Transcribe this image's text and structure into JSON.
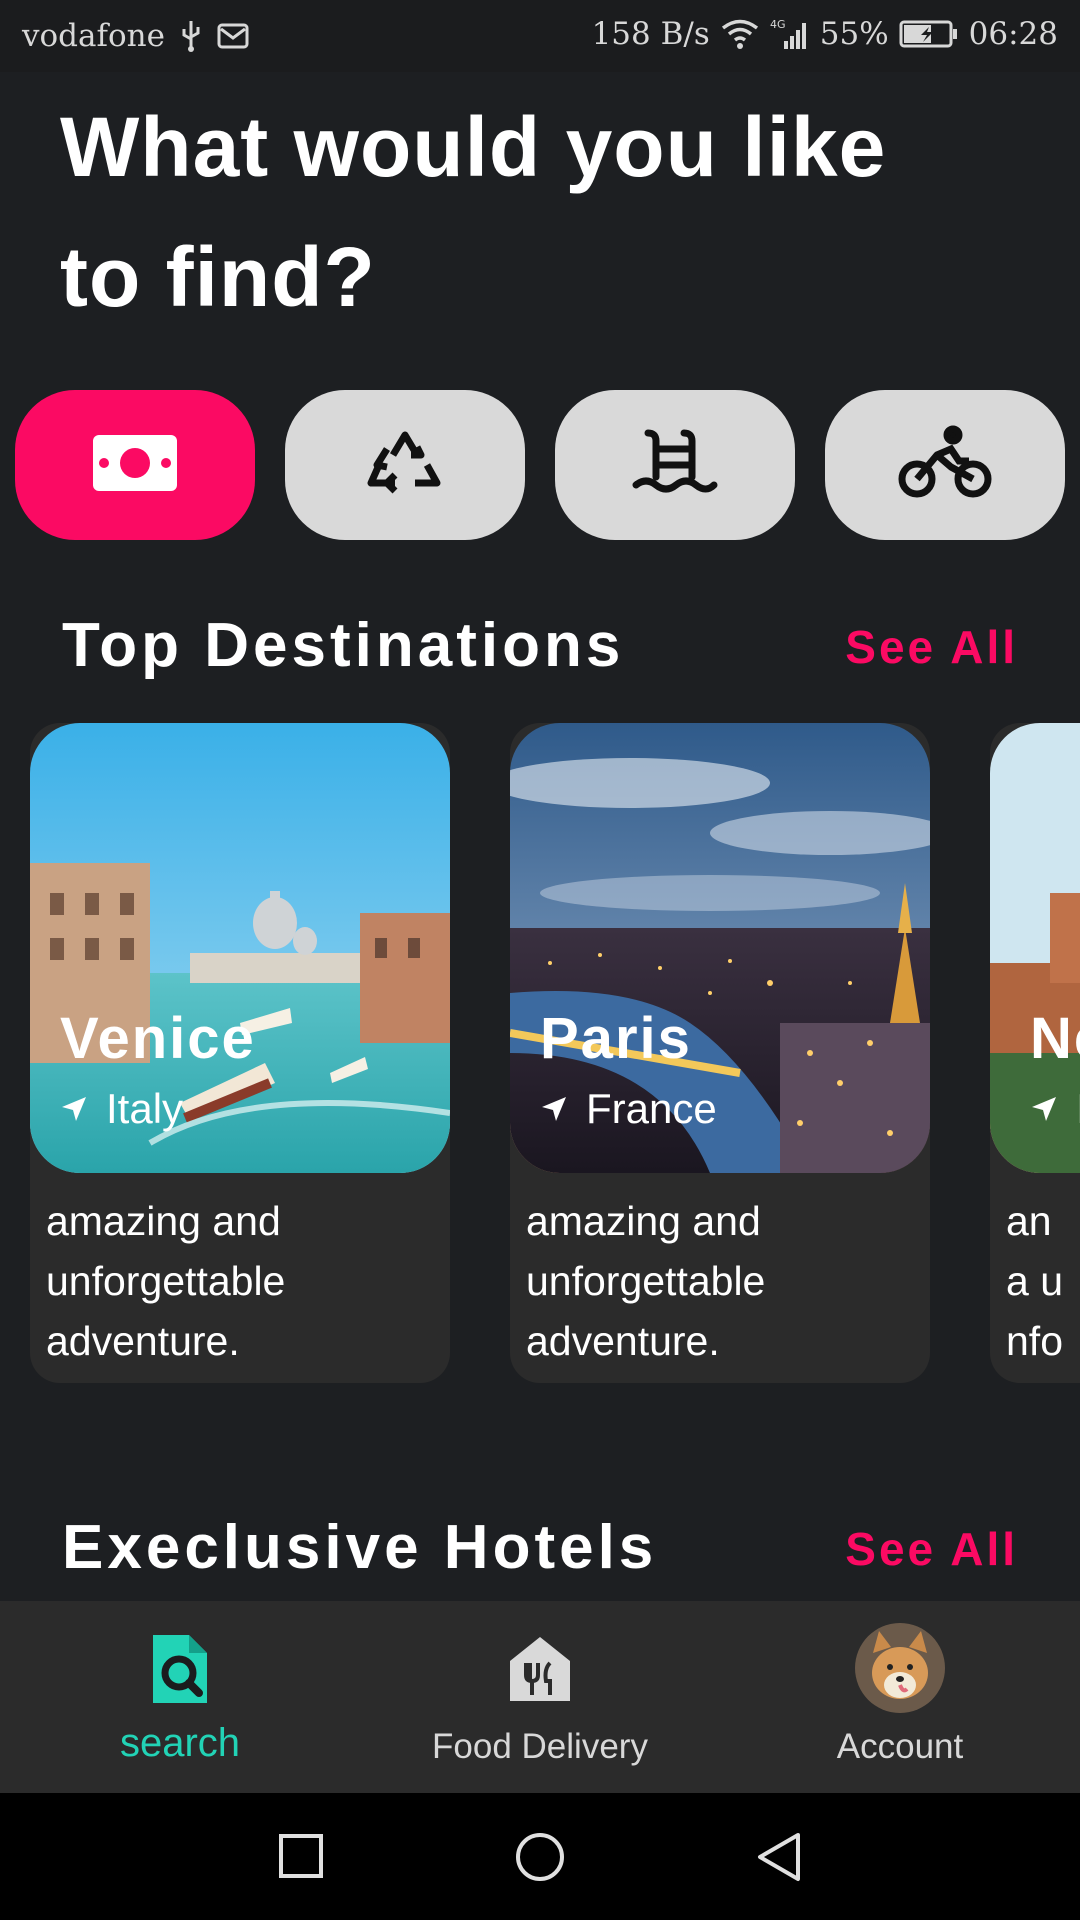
{
  "status_bar": {
    "carrier": "vodafone",
    "net_speed": "158 B/s",
    "battery": "55%",
    "time": "06:28"
  },
  "headline": "What would you like to find?",
  "categories": [
    {
      "icon": "money-icon",
      "active": true
    },
    {
      "icon": "recycle-icon",
      "active": false
    },
    {
      "icon": "pool-icon",
      "active": false
    },
    {
      "icon": "bicycle-icon",
      "active": false
    }
  ],
  "top_destinations": {
    "title": "Top Destinations",
    "see_all": "See All",
    "cards": [
      {
        "city": "Venice",
        "country": "Italy",
        "description": "amazing and unforgettable adventure."
      },
      {
        "city": "Paris",
        "country": "France",
        "description": "amazing and unforgettable adventure."
      },
      {
        "city": "Ne",
        "country": "I",
        "description": "an a unfo adve"
      }
    ]
  },
  "hotels": {
    "title": "Execlusive Hotels",
    "see_all": "See All"
  },
  "bottom_nav": {
    "items": [
      {
        "label": "search",
        "icon": "search-doc-icon",
        "active": true
      },
      {
        "label": "Food Delivery",
        "icon": "food-icon",
        "active": false
      },
      {
        "label": "Account",
        "icon": "avatar",
        "active": false
      }
    ]
  },
  "colors": {
    "accent": "#fb0a63",
    "active_nav": "#22d3b6",
    "background": "#1d1f22",
    "card": "#2b2b2b"
  }
}
